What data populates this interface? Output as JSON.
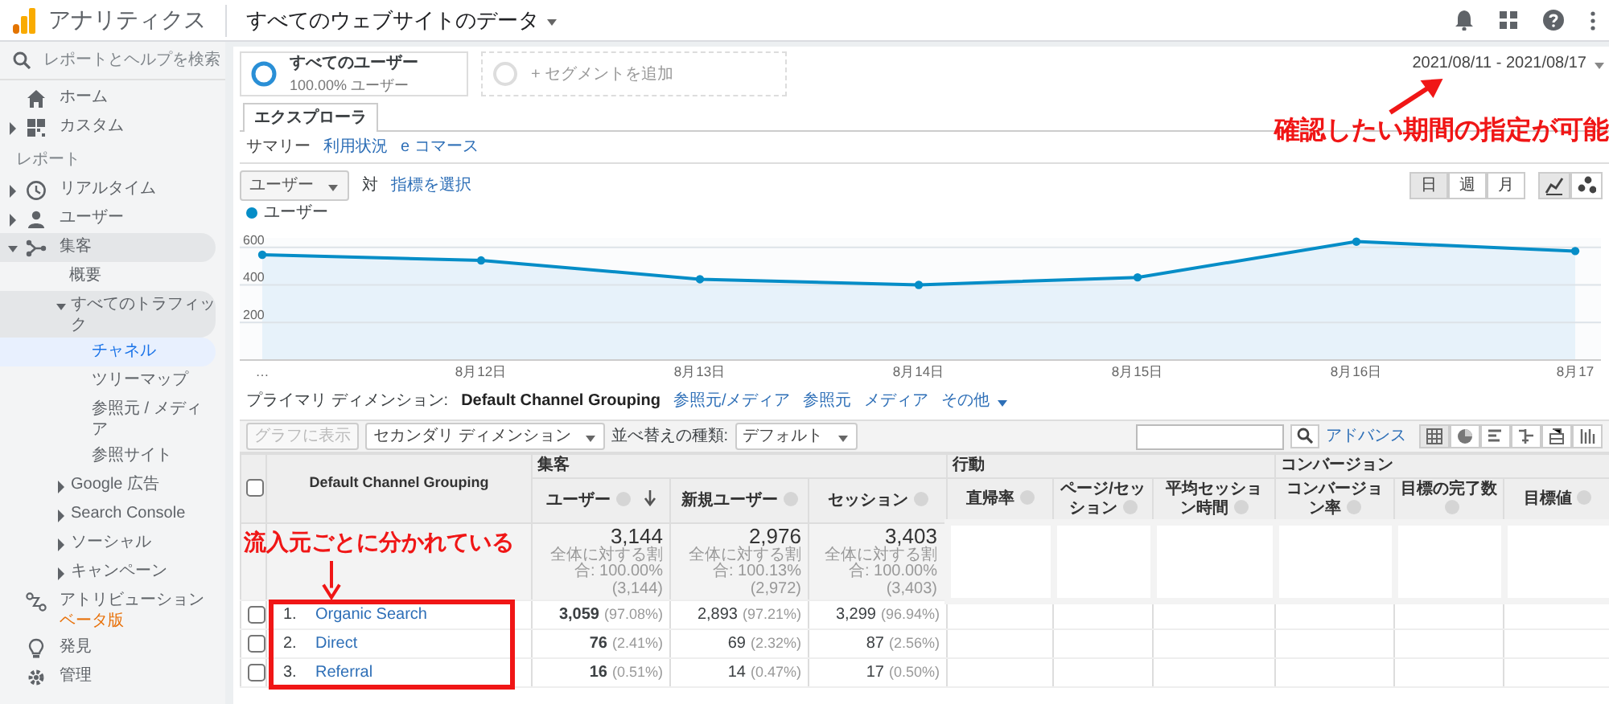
{
  "app": {
    "title": "アナリティクス",
    "property": "すべてのウェブサイトのデータ"
  },
  "sidebar": {
    "search_placeholder": "レポートとヘルプを検索",
    "items": [
      {
        "kind": "link",
        "label": "ホーム",
        "selected": false
      },
      {
        "kind": "group",
        "label": "カスタム",
        "expanded": false
      },
      {
        "kind": "heading",
        "label": "レポート"
      },
      {
        "kind": "group",
        "label": "リアルタイム",
        "expanded": false
      },
      {
        "kind": "group",
        "label": "ユーザー",
        "expanded": false
      },
      {
        "kind": "group",
        "label": "集客",
        "expanded": true,
        "children": [
          {
            "kind": "link",
            "label": "概要",
            "selected": false
          },
          {
            "kind": "group",
            "label": "すべてのトラフィック",
            "expanded": true,
            "children": [
              {
                "kind": "link",
                "label": "チャネル",
                "selected": true
              },
              {
                "kind": "link",
                "label": "ツリーマップ",
                "selected": false
              },
              {
                "kind": "link",
                "label": "参照元 / メディア",
                "selected": false
              },
              {
                "kind": "link",
                "label": "参照サイト",
                "selected": false
              }
            ]
          },
          {
            "kind": "group",
            "label": "Google 広告",
            "expanded": false
          },
          {
            "kind": "group",
            "label": "Search Console",
            "expanded": false
          },
          {
            "kind": "group",
            "label": "ソーシャル",
            "expanded": false
          },
          {
            "kind": "group",
            "label": "キャンペーン",
            "expanded": false
          }
        ]
      },
      {
        "kind": "link",
        "label": "アトリビューション",
        "badge": "ベータ版",
        "selected": false
      },
      {
        "kind": "link",
        "label": "発見",
        "selected": false
      },
      {
        "kind": "link",
        "label": "管理",
        "selected": false
      }
    ]
  },
  "segments": [
    {
      "kind": "active",
      "name": "すべてのユーザー",
      "detail": "100.00% ユーザー"
    },
    {
      "kind": "add",
      "name": "+ セグメントを追加"
    }
  ],
  "date_range": "2021/08/11 - 2021/08/17",
  "tabs": [
    {
      "label": "エクスプローラ",
      "selected": true
    }
  ],
  "subtabs": [
    {
      "label": "サマリー",
      "selected": true
    },
    {
      "label": "利用状況",
      "selected": false
    },
    {
      "label": "e コマース",
      "selected": false
    }
  ],
  "metric": {
    "value": "ユーザー",
    "vs": "対",
    "link": "指標を選択"
  },
  "granularity": [
    {
      "label": "日",
      "selected": true
    },
    {
      "label": "週",
      "selected": false
    },
    {
      "label": "月",
      "selected": false
    }
  ],
  "chart_types": [
    {
      "selected": true
    },
    {
      "selected": false
    }
  ],
  "chart": {
    "chart_data": {
      "type": "area",
      "grid": true,
      "marker": true,
      "categories": [
        "…",
        "8月12日",
        "8月13日",
        "8月14日",
        "8月15日",
        "8月16日",
        "8月17"
      ],
      "series": [
        {
          "name": "ユーザー",
          "color": "#058dc7",
          "values": [
            560,
            530,
            430,
            400,
            440,
            630,
            580
          ]
        }
      ],
      "ylim": [
        0,
        650
      ],
      "yticks": [
        200,
        400,
        600
      ]
    }
  },
  "dimensions": {
    "label": "プライマリ ディメンション:",
    "options": [
      {
        "label": "Default Channel Grouping",
        "selected": true
      },
      {
        "label": "参照元/メディア",
        "selected": false
      },
      {
        "label": "参照元",
        "selected": false
      },
      {
        "label": "メディア",
        "selected": false
      },
      {
        "label": "その他",
        "selected": false
      }
    ]
  },
  "toolbar": {
    "plot_button": {
      "label": "グラフに表示",
      "disabled": true
    },
    "secondary": "セカンダリ ディメンション",
    "sort_label": "並べ替えの種類:",
    "sort": "デフォルト",
    "advanced": "アドバンス",
    "views": [
      {
        "selected": true
      },
      {
        "selected": false
      },
      {
        "selected": false
      },
      {
        "selected": false
      },
      {
        "selected": false
      },
      {
        "selected": false
      }
    ]
  },
  "table": {
    "select_all": {
      "checked": false
    },
    "dimension_header": "Default Channel Grouping",
    "groups": [
      {
        "label": "集客",
        "columns": [
          {
            "label": "ユーザー",
            "sorted": true
          },
          {
            "label": "新規ユーザー",
            "sorted": false
          },
          {
            "label": "セッション",
            "sorted": false
          }
        ]
      },
      {
        "label": "行動",
        "columns": [
          {
            "label": "直帰率",
            "sorted": false
          },
          {
            "label": "ページ/セッション",
            "sorted": false
          },
          {
            "label": "平均セッション時間",
            "sorted": false
          }
        ]
      },
      {
        "label": "コンバージョン",
        "columns": [
          {
            "label": "コンバージョン率",
            "sorted": false
          },
          {
            "label": "目標の完了数",
            "sorted": false
          },
          {
            "label": "目標値",
            "sorted": false
          }
        ]
      }
    ],
    "totals": [
      {
        "value": "3,144",
        "share": "全体に対する割合: 100.00%",
        "base": "(3,144)"
      },
      {
        "value": "2,976",
        "share": "全体に対する割合: 100.13%",
        "base": "(2,972)"
      },
      {
        "value": "3,403",
        "share": "全体に対する割合: 100.00%",
        "base": "(3,403)"
      }
    ],
    "rows": [
      {
        "rank": "1.",
        "channel": "Organic Search",
        "checked": false,
        "cells": [
          {
            "value": "3,059",
            "pct": "(97.08%)"
          },
          {
            "value": "2,893",
            "pct": "(97.21%)"
          },
          {
            "value": "3,299",
            "pct": "(96.94%)"
          }
        ]
      },
      {
        "rank": "2.",
        "channel": "Direct",
        "checked": false,
        "cells": [
          {
            "value": "76",
            "pct": "(2.41%)"
          },
          {
            "value": "69",
            "pct": "(2.32%)"
          },
          {
            "value": "87",
            "pct": "(2.56%)"
          }
        ]
      },
      {
        "rank": "3.",
        "channel": "Referral",
        "checked": false,
        "cells": [
          {
            "value": "16",
            "pct": "(0.51%)"
          },
          {
            "value": "14",
            "pct": "(0.47%)"
          },
          {
            "value": "17",
            "pct": "(0.50%)"
          }
        ]
      }
    ]
  },
  "annotations": [
    {
      "kind": "date-note",
      "text": "確認したい期間の指定が可能"
    },
    {
      "kind": "channel-note",
      "text": "流入元ごとに分かれている"
    }
  ]
}
